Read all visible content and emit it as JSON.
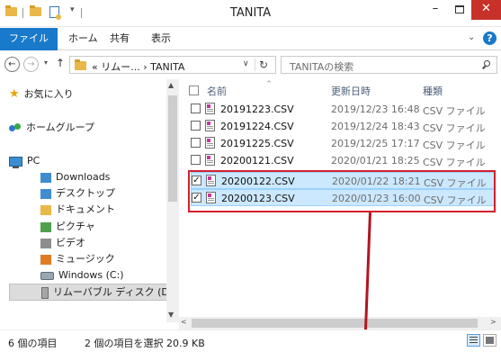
{
  "window": {
    "title": "TANITA",
    "minimize": "–",
    "close": "✕"
  },
  "quick_access": {
    "dropdown": "▾"
  },
  "ribbon": {
    "tabs": [
      "ファイル",
      "ホーム",
      "共有",
      "表示"
    ],
    "expand_icon": "⌄",
    "help": "?"
  },
  "navigation": {
    "back": "←",
    "forward": "→",
    "recent": "▾",
    "up": "↑",
    "address_overflow": "« リムー... › TANITA",
    "address_dropdown": "∨",
    "refresh": "↻",
    "search_placeholder": "TANITAの検索"
  },
  "sidebar": {
    "items": [
      {
        "label": "お気に入り",
        "icon": "star-icon"
      },
      {
        "label": "ホームグループ",
        "icon": "homegroup-icon"
      },
      {
        "label": "PC",
        "icon": "computer-icon"
      },
      {
        "label": "Downloads",
        "icon": "folder-icon"
      },
      {
        "label": "デスクトップ",
        "icon": "folder-icon"
      },
      {
        "label": "ドキュメント",
        "icon": "folder-icon"
      },
      {
        "label": "ピクチャ",
        "icon": "folder-icon"
      },
      {
        "label": "ビデオ",
        "icon": "folder-icon"
      },
      {
        "label": "ミュージック",
        "icon": "folder-icon"
      },
      {
        "label": "Windows (C:)",
        "icon": "drive-icon"
      },
      {
        "label": "リムーバブル ディスク (D:)",
        "icon": "usb-drive-icon"
      }
    ],
    "star_glyph": "★",
    "scroll_up": "▲",
    "scroll_down": "▼"
  },
  "file_list": {
    "columns": {
      "name": "名前",
      "date": "更新日時",
      "type": "種類"
    },
    "sort_indicator": "^",
    "rows": [
      {
        "name": "20191223.CSV",
        "date": "2019/12/23 16:48",
        "type": "CSV ファイル",
        "selected": false
      },
      {
        "name": "20191224.CSV",
        "date": "2019/12/24 18:43",
        "type": "CSV ファイル",
        "selected": false
      },
      {
        "name": "20191225.CSV",
        "date": "2019/12/25 17:17",
        "type": "CSV ファイル",
        "selected": false
      },
      {
        "name": "20200121.CSV",
        "date": "2020/01/21 18:25",
        "type": "CSV ファイル",
        "selected": false
      },
      {
        "name": "20200122.CSV",
        "date": "2020/01/22 18:21",
        "type": "CSV ファイル",
        "selected": true
      },
      {
        "name": "20200123.CSV",
        "date": "2020/01/23 16:00",
        "type": "CSV ファイル",
        "selected": true
      }
    ],
    "check_glyph": "✓",
    "scroll_left": "<",
    "scroll_right": ">"
  },
  "status": {
    "item_count": "6 個の項目",
    "selected": "2 個の項目を選択  20.9 KB"
  },
  "colors": {
    "accent": "#1979ca",
    "selection": "#cce8ff",
    "highlight": "#d3202d",
    "close_button": "#c7312a"
  }
}
